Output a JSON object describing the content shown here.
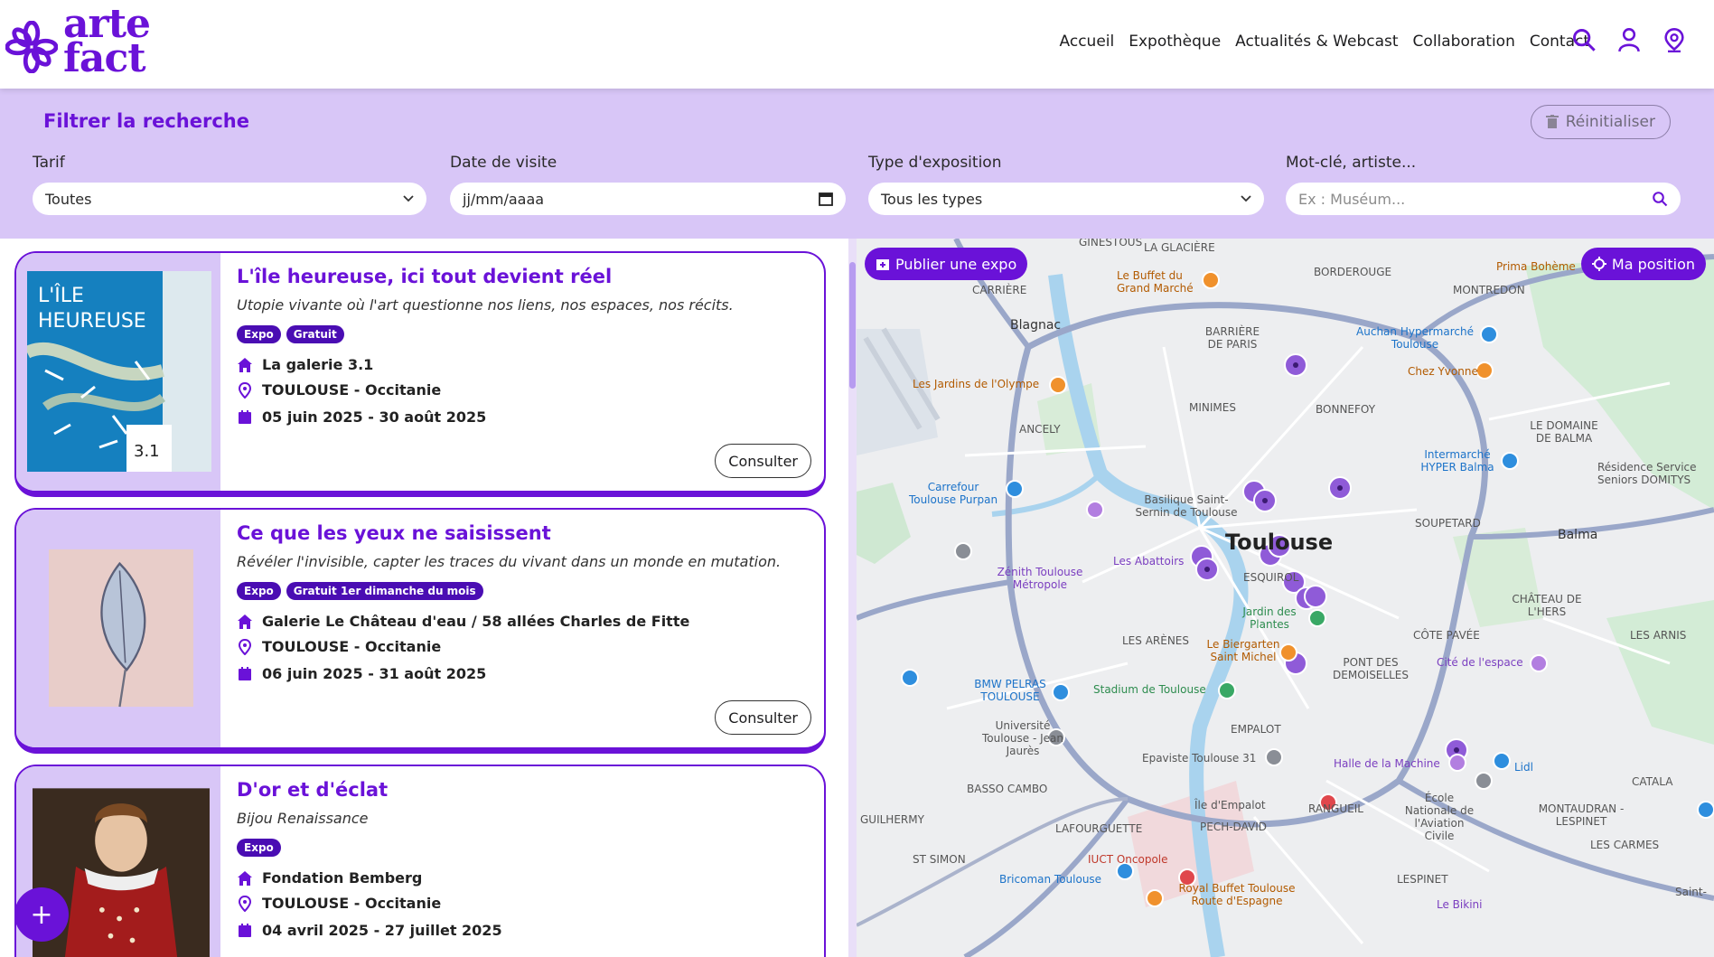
{
  "header": {
    "logo_line1": "arte",
    "logo_line2": "fact",
    "nav": [
      "Accueil",
      "Expothèque",
      "Actualités & Webcast",
      "Collaboration",
      "Contact"
    ],
    "icons": [
      "search-icon",
      "user-icon",
      "location-pin-icon"
    ]
  },
  "filters": {
    "title": "Filtrer la recherche",
    "reset_label": "Réinitialiser",
    "tarif_label": "Tarif",
    "tarif_value": "Toutes",
    "date_label": "Date de visite",
    "date_placeholder": "jj/mm/aaaa",
    "type_label": "Type d'exposition",
    "type_value": "Tous les types",
    "keyword_label": "Mot-clé, artiste...",
    "keyword_placeholder": "Ex : Muséum..."
  },
  "cards": [
    {
      "title": "L'île heureuse, ici tout devient réel",
      "subtitle": "Utopie vivante où l'art questionne nos liens, nos espaces, nos récits.",
      "tags": [
        "Expo",
        "Gratuit"
      ],
      "venue": "La galerie 3.1",
      "city": "TOULOUSE - Occitanie",
      "dates": "05 juin 2025  -  30 août 2025",
      "button": "Consulter"
    },
    {
      "title": "Ce que les yeux ne saisissent",
      "subtitle": "Révéler l'invisible, capter les traces du vivant dans un monde en mutation.",
      "tags": [
        "Expo",
        "Gratuit 1er dimanche du mois"
      ],
      "venue": "Galerie Le Château d'eau / 58 allées Charles de Fitte",
      "city": "TOULOUSE - Occitanie",
      "dates": "06 juin 2025  -  31 août 2025",
      "button": "Consulter"
    },
    {
      "title": "D'or et d'éclat",
      "subtitle": "Bijou Renaissance",
      "tags": [
        "Expo"
      ],
      "venue": "Fondation Bemberg",
      "city": "TOULOUSE - Occitanie",
      "dates": "04 avril 2025  -  27 juillet 2025",
      "button": "Consulter"
    }
  ],
  "fab_label": "+",
  "map": {
    "publish_label": "Publier une expo",
    "position_label": "Ma position",
    "labels": [
      "GINESTOUS",
      "LA GLACIÈRE",
      "BORDEROUGE",
      "MONTREDON",
      "CARRIÈRE",
      "Blagnac",
      "Le Buffet du Grand Marché",
      "Prima Bohème",
      "BARRIÈRE DE PARIS",
      "Auchan Hypermarché Toulouse",
      "Chez Yvonne",
      "Les Jardins de l'Olympe",
      "MINIMES",
      "BONNEFOY",
      "ANCELY",
      "LE DOMAINE DE BALMA",
      "Intermarché HYPER Balma",
      "Résidence Service Seniors DOMITYS",
      "Carrefour Toulouse Purpan",
      "Basilique Saint-Sernin de Toulouse",
      "Toulouse",
      "SOUPETARD",
      "Balma",
      "Zénith Toulouse Métropole",
      "Les Abattoirs",
      "ESQUIROL",
      "Jardin des Plantes",
      "CHÂTEAU DE L'HERS",
      "LES ARÈNES",
      "Le Biergarten Saint Michel",
      "CÔTE PAVÉE",
      "LES ARNIS",
      "PONT DES DEMOISELLES",
      "Cité de l'espace",
      "BMW PELRAS TOULOUSE",
      "Stadium de Toulouse",
      "Université Toulouse - Jean Jaurès",
      "EMPALOT",
      "Epaviste Toulouse 31",
      "Halle de la Machine",
      "Lidl",
      "BASSO CAMBO",
      "Île d'Empalot",
      "RANGUEIL",
      "École Nationale de l'Aviation Civile",
      "MONTAUDRAN - LESPINET",
      "CATALA",
      "GUILHERMY",
      "LAFOURGUETTE",
      "PECH-DAVID",
      "ST SIMON",
      "IUCT Oncopole",
      "LES CARMES",
      "Bricoman Toulouse",
      "Royal Buffet Toulouse Route d'Espagne",
      "LESPINET",
      "Le Bikini",
      "Saint-"
    ]
  },
  "colors": {
    "accent": "#6a12d8",
    "filter_bg": "#d8c6f7",
    "tag_bg": "#4a0db3"
  }
}
